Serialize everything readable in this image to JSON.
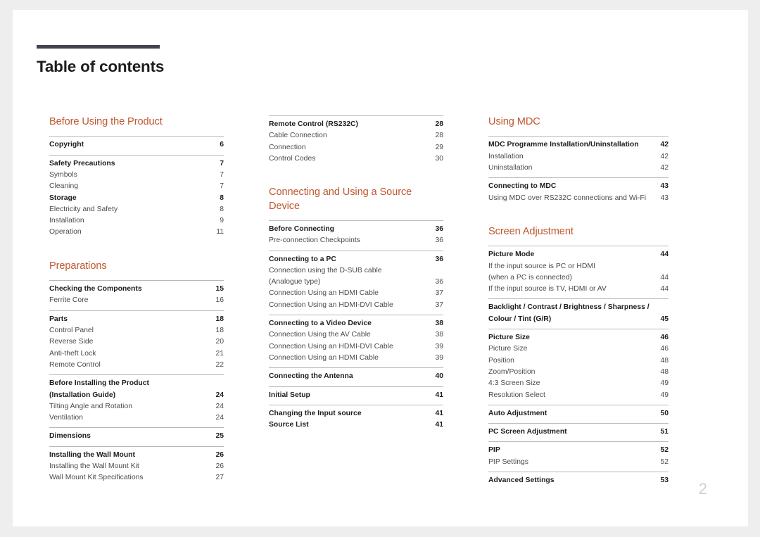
{
  "document": {
    "title": "Table of contents",
    "folio": "2",
    "accent_color": "#c0562f",
    "rule_color": "#43424e"
  },
  "columns": [
    {
      "id": "column-1",
      "sections": [
        {
          "heading": "Before Using the Product",
          "groups": [
            {
              "entries": [
                {
                  "label": "Copyright",
                  "page": "6",
                  "bold": true
                }
              ]
            },
            {
              "entries": [
                {
                  "label": "Safety Precautions",
                  "page": "7",
                  "bold": true
                },
                {
                  "label": "Symbols",
                  "page": "7",
                  "bold": false
                },
                {
                  "label": "Cleaning",
                  "page": "7",
                  "bold": false
                },
                {
                  "label": "Storage",
                  "page": "8",
                  "bold": true
                },
                {
                  "label": "Electricity and Safety",
                  "page": "8",
                  "bold": false
                },
                {
                  "label": "Installation",
                  "page": "9",
                  "bold": false
                },
                {
                  "label": "Operation",
                  "page": "11",
                  "bold": false
                }
              ]
            }
          ]
        },
        {
          "heading": "Preparations",
          "groups": [
            {
              "entries": [
                {
                  "label": "Checking the Components",
                  "page": "15",
                  "bold": true
                },
                {
                  "label": "Ferrite Core",
                  "page": "16",
                  "bold": false
                }
              ]
            },
            {
              "entries": [
                {
                  "label": "Parts",
                  "page": "18",
                  "bold": true
                },
                {
                  "label": "Control Panel",
                  "page": "18",
                  "bold": false
                },
                {
                  "label": "Reverse Side",
                  "page": "20",
                  "bold": false
                },
                {
                  "label": "Anti-theft Lock",
                  "page": "21",
                  "bold": false
                },
                {
                  "label": "Remote Control",
                  "page": "22",
                  "bold": false
                }
              ]
            },
            {
              "entries": [
                {
                  "label": "Before Installing the Product",
                  "page": "",
                  "bold": true,
                  "continued": true
                },
                {
                  "label": "(Installation Guide)",
                  "page": "24",
                  "bold": true
                },
                {
                  "label": "Tilting Angle and Rotation",
                  "page": "24",
                  "bold": false
                },
                {
                  "label": "Ventilation",
                  "page": "24",
                  "bold": false
                }
              ]
            },
            {
              "entries": [
                {
                  "label": "Dimensions",
                  "page": "25",
                  "bold": true
                }
              ]
            },
            {
              "entries": [
                {
                  "label": "Installing the Wall Mount",
                  "page": "26",
                  "bold": true
                },
                {
                  "label": "Installing the Wall Mount Kit",
                  "page": "26",
                  "bold": false
                },
                {
                  "label": "Wall Mount Kit Specifications",
                  "page": "27",
                  "bold": false
                }
              ]
            }
          ]
        }
      ]
    },
    {
      "id": "column-2",
      "sections": [
        {
          "heading": "",
          "groups": [
            {
              "entries": [
                {
                  "label": "Remote Control (RS232C)",
                  "page": "28",
                  "bold": true
                },
                {
                  "label": "Cable Connection",
                  "page": "28",
                  "bold": false
                },
                {
                  "label": "Connection",
                  "page": "29",
                  "bold": false
                },
                {
                  "label": "Control Codes",
                  "page": "30",
                  "bold": false
                }
              ]
            }
          ]
        },
        {
          "heading": "Connecting and Using a Source Device",
          "groups": [
            {
              "entries": [
                {
                  "label": "Before Connecting",
                  "page": "36",
                  "bold": true
                },
                {
                  "label": "Pre-connection Checkpoints",
                  "page": "36",
                  "bold": false
                }
              ]
            },
            {
              "entries": [
                {
                  "label": "Connecting to a PC",
                  "page": "36",
                  "bold": true
                },
                {
                  "label": "Connection using the D-SUB cable",
                  "page": "",
                  "bold": false,
                  "continued": true
                },
                {
                  "label": "(Analogue type)",
                  "page": "36",
                  "bold": false
                },
                {
                  "label": "Connection Using an HDMI Cable",
                  "page": "37",
                  "bold": false
                },
                {
                  "label": "Connection Using an HDMI-DVI Cable",
                  "page": "37",
                  "bold": false
                }
              ]
            },
            {
              "entries": [
                {
                  "label": "Connecting to a Video Device",
                  "page": "38",
                  "bold": true
                },
                {
                  "label": "Connection Using the AV Cable",
                  "page": "38",
                  "bold": false
                },
                {
                  "label": "Connection Using an HDMI-DVI Cable",
                  "page": "39",
                  "bold": false
                },
                {
                  "label": "Connection Using an HDMI Cable",
                  "page": "39",
                  "bold": false
                }
              ]
            },
            {
              "entries": [
                {
                  "label": "Connecting the Antenna",
                  "page": "40",
                  "bold": true
                }
              ]
            },
            {
              "entries": [
                {
                  "label": "Initial Setup",
                  "page": "41",
                  "bold": true
                }
              ]
            },
            {
              "entries": [
                {
                  "label": "Changing the Input source",
                  "page": "41",
                  "bold": true
                },
                {
                  "label": "Source List",
                  "page": "41",
                  "bold": true
                }
              ]
            }
          ]
        }
      ]
    },
    {
      "id": "column-3",
      "sections": [
        {
          "heading": "Using MDC",
          "groups": [
            {
              "entries": [
                {
                  "label": "MDC Programme Installation/Uninstallation",
                  "page": "42",
                  "bold": true
                },
                {
                  "label": "Installation",
                  "page": "42",
                  "bold": false
                },
                {
                  "label": "Uninstallation",
                  "page": "42",
                  "bold": false
                }
              ]
            },
            {
              "entries": [
                {
                  "label": "Connecting to MDC",
                  "page": "43",
                  "bold": true
                },
                {
                  "label": "Using MDC over RS232C connections and Wi-Fi",
                  "page": "43",
                  "bold": false
                }
              ]
            }
          ]
        },
        {
          "heading": "Screen Adjustment",
          "groups": [
            {
              "entries": [
                {
                  "label": "Picture Mode",
                  "page": "44",
                  "bold": true
                },
                {
                  "label": "If the input source is PC or HDMI",
                  "page": "",
                  "bold": false,
                  "continued": true
                },
                {
                  "label": "(when a PC is connected)",
                  "page": "44",
                  "bold": false
                },
                {
                  "label": "If the input source is TV, HDMI or AV",
                  "page": "44",
                  "bold": false
                }
              ]
            },
            {
              "entries": [
                {
                  "label": "Backlight / Contrast / Brightness / Sharpness /",
                  "page": "",
                  "bold": true,
                  "continued": true
                },
                {
                  "label": "Colour / Tint (G/R)",
                  "page": "45",
                  "bold": true
                }
              ]
            },
            {
              "entries": [
                {
                  "label": "Picture Size",
                  "page": "46",
                  "bold": true
                },
                {
                  "label": "Picture Size",
                  "page": "46",
                  "bold": false
                },
                {
                  "label": "Position",
                  "page": "48",
                  "bold": false
                },
                {
                  "label": "Zoom/Position",
                  "page": "48",
                  "bold": false
                },
                {
                  "label": "4:3 Screen Size",
                  "page": "49",
                  "bold": false
                },
                {
                  "label": "Resolution Select",
                  "page": "49",
                  "bold": false
                }
              ]
            },
            {
              "entries": [
                {
                  "label": "Auto Adjustment",
                  "page": "50",
                  "bold": true
                }
              ]
            },
            {
              "entries": [
                {
                  "label": "PC Screen Adjustment",
                  "page": "51",
                  "bold": true
                }
              ]
            },
            {
              "entries": [
                {
                  "label": "PIP",
                  "page": "52",
                  "bold": true
                },
                {
                  "label": "PIP Settings",
                  "page": "52",
                  "bold": false
                }
              ]
            },
            {
              "entries": [
                {
                  "label": "Advanced Settings",
                  "page": "53",
                  "bold": true
                }
              ]
            }
          ]
        }
      ]
    }
  ]
}
